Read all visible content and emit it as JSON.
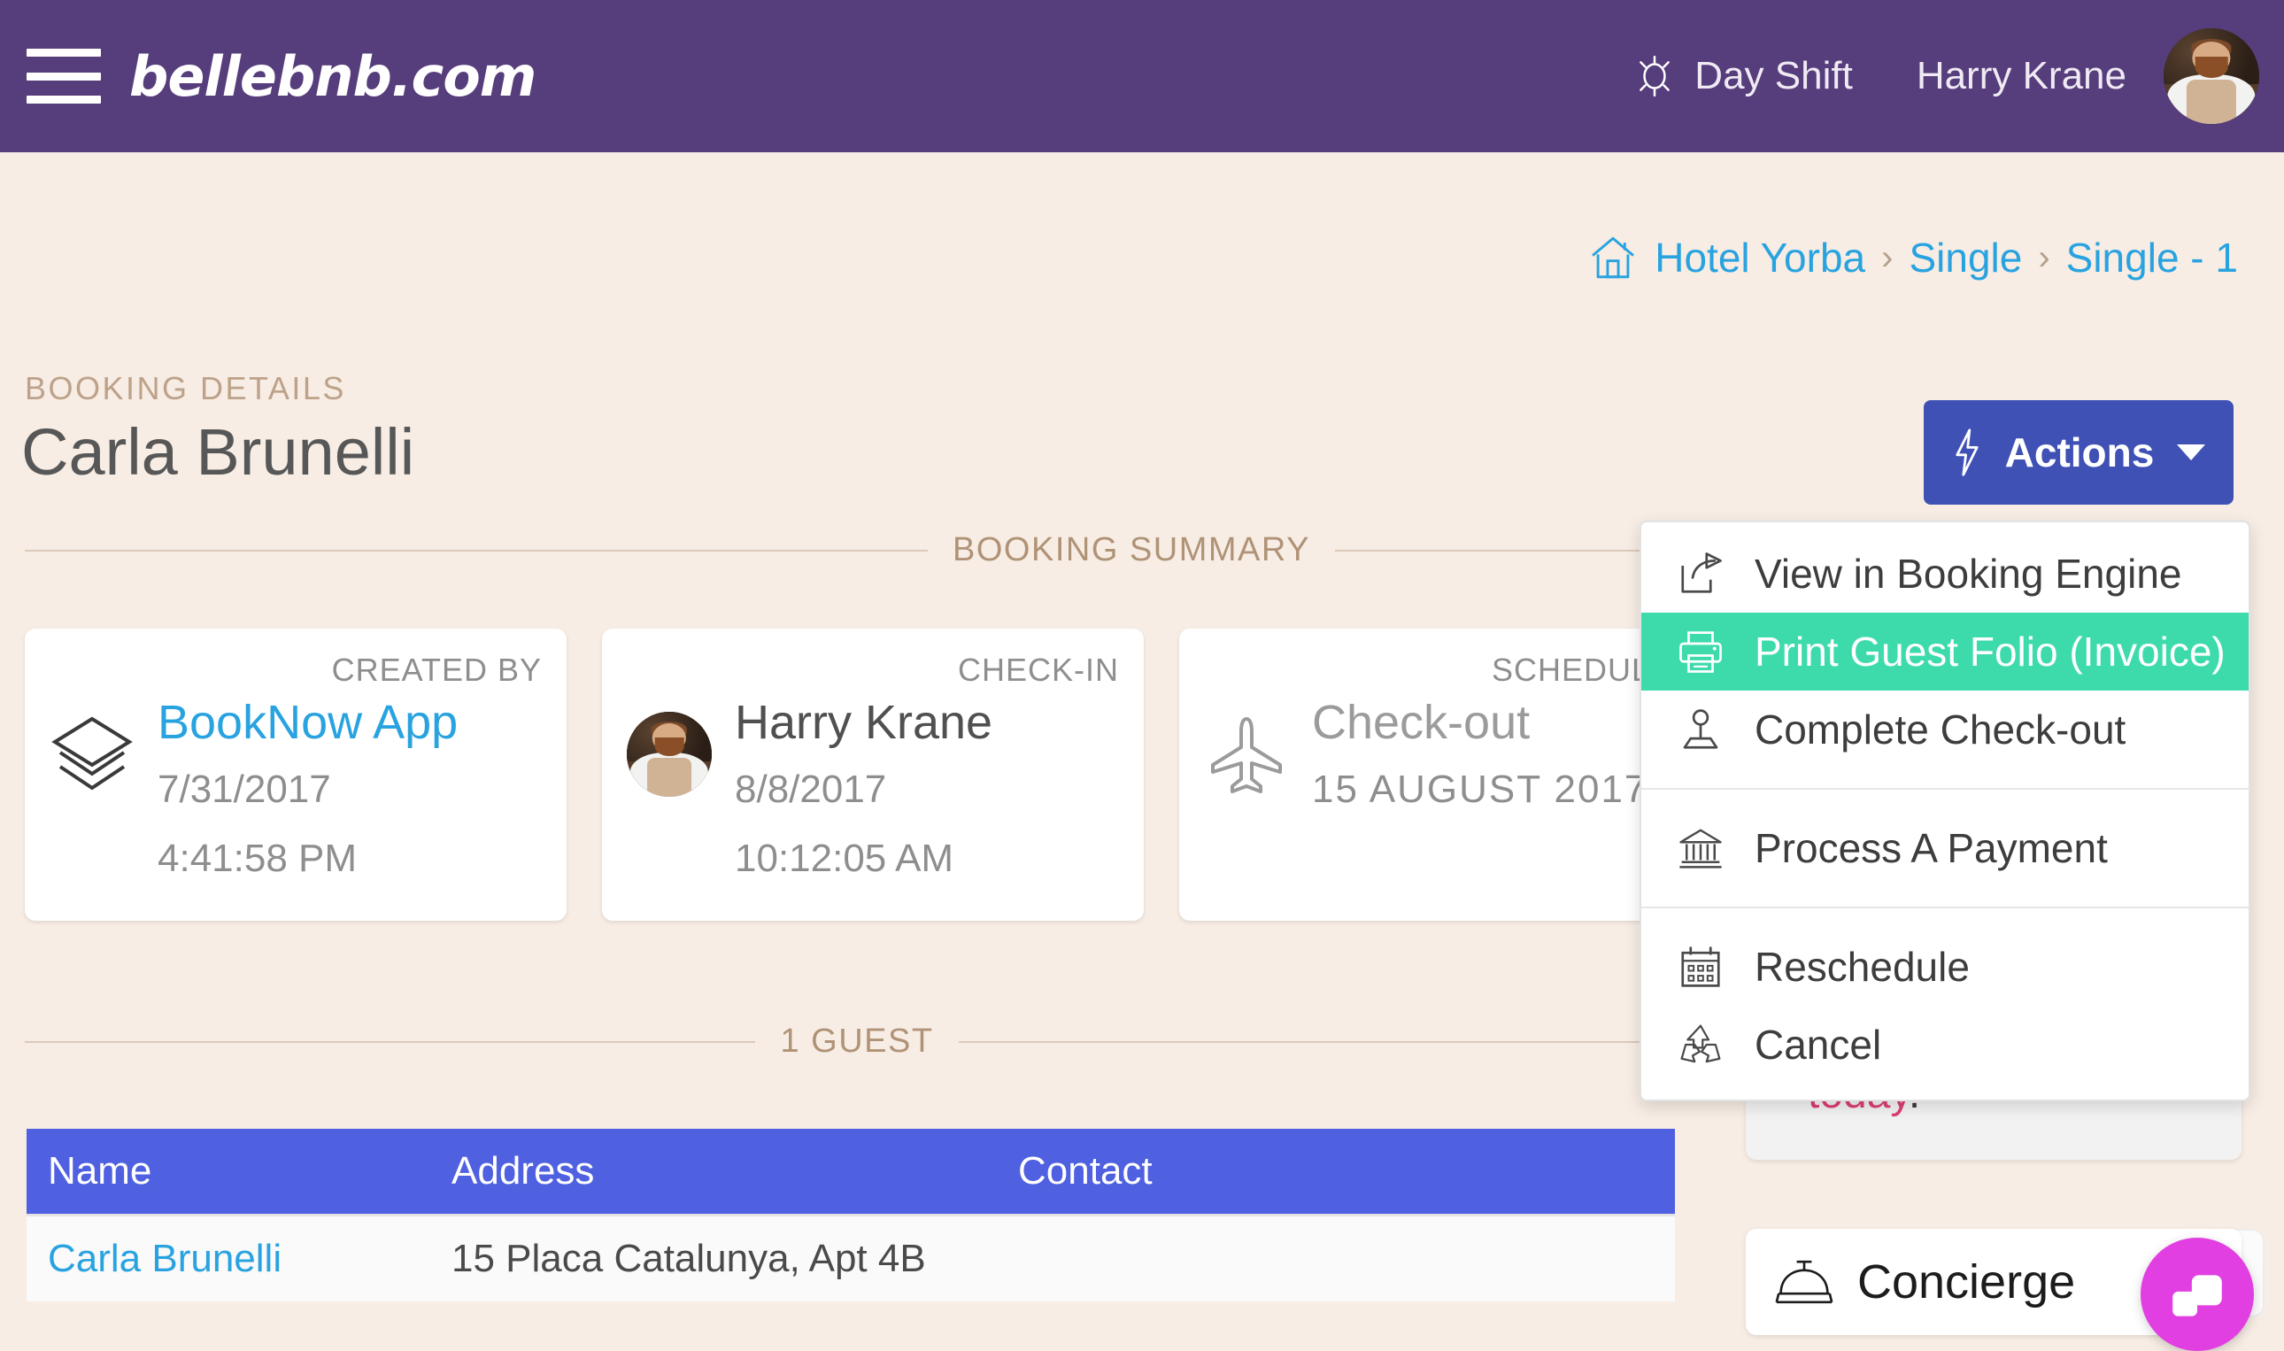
{
  "topbar": {
    "brand": "bellebnb.com",
    "shift_label": "Day Shift",
    "user_name": "Harry Krane",
    "menu_icon": "hamburger-icon",
    "shift_icon": "sun-icon",
    "avatar_icon": "user-avatar",
    "bg_color": "#563d7c"
  },
  "breadcrumb": {
    "home_icon": "home-icon",
    "items": [
      {
        "label": "Hotel Yorba"
      },
      {
        "label": "Single"
      },
      {
        "label": "Single - 1"
      }
    ],
    "separator": "›",
    "link_color": "#29a3e0"
  },
  "page": {
    "eyebrow": "BOOKING DETAILS",
    "title": "Carla Brunelli"
  },
  "actions_button": {
    "label": "Actions",
    "icon": "bolt-icon",
    "caret_icon": "chevron-down-icon",
    "color": "#3f51b5"
  },
  "sections": {
    "summary_title": "BOOKING SUMMARY",
    "guests_title": "1 GUEST"
  },
  "summary_cards": [
    {
      "kicker": "CREATED BY",
      "icon": "layers-icon",
      "main": "BookNow App",
      "main_style": "link",
      "date": "7/31/2017",
      "time": "4:41:58 PM"
    },
    {
      "kicker": "CHECK-IN",
      "icon": "user-avatar",
      "main": "Harry Krane",
      "main_style": "dark",
      "date": "8/8/2017",
      "time": "10:12:05 AM"
    },
    {
      "kicker": "SCHEDULED",
      "icon": "airplane-icon",
      "main": "Check-out",
      "main_style": "muted",
      "date": "15 AUGUST 2017",
      "time": ""
    }
  ],
  "guest_table": {
    "columns": [
      "Name",
      "Address",
      "Contact"
    ],
    "rows": [
      {
        "name": "Carla Brunelli",
        "address": "15 Placa Catalunya, Apt 4B",
        "contact": ""
      }
    ],
    "header_color": "#4f60e0"
  },
  "dropdown": {
    "groups": [
      {
        "items": [
          {
            "label": "View in Booking Engine",
            "icon": "share-icon",
            "active": false
          },
          {
            "label": "Print Guest Folio (Invoice)",
            "icon": "printer-icon",
            "active": true
          },
          {
            "label": "Complete Check-out",
            "icon": "stamp-icon",
            "active": false
          }
        ]
      },
      {
        "items": [
          {
            "label": "Process A Payment",
            "icon": "bank-icon",
            "active": false
          }
        ]
      },
      {
        "items": [
          {
            "label": "Reschedule",
            "icon": "calendar-icon",
            "active": false
          },
          {
            "label": "Cancel",
            "icon": "recycle-icon",
            "active": false
          }
        ]
      }
    ],
    "highlight_color": "#3ddbac"
  },
  "right_panel": {
    "note_text": "today",
    "note_period": ".",
    "note_color": "#dd3e77",
    "concierge_label": "Concierge",
    "concierge_icon": "bell-icon",
    "chat_icon": "chat-bubble-icon",
    "chat_color": "#e13fe1"
  }
}
